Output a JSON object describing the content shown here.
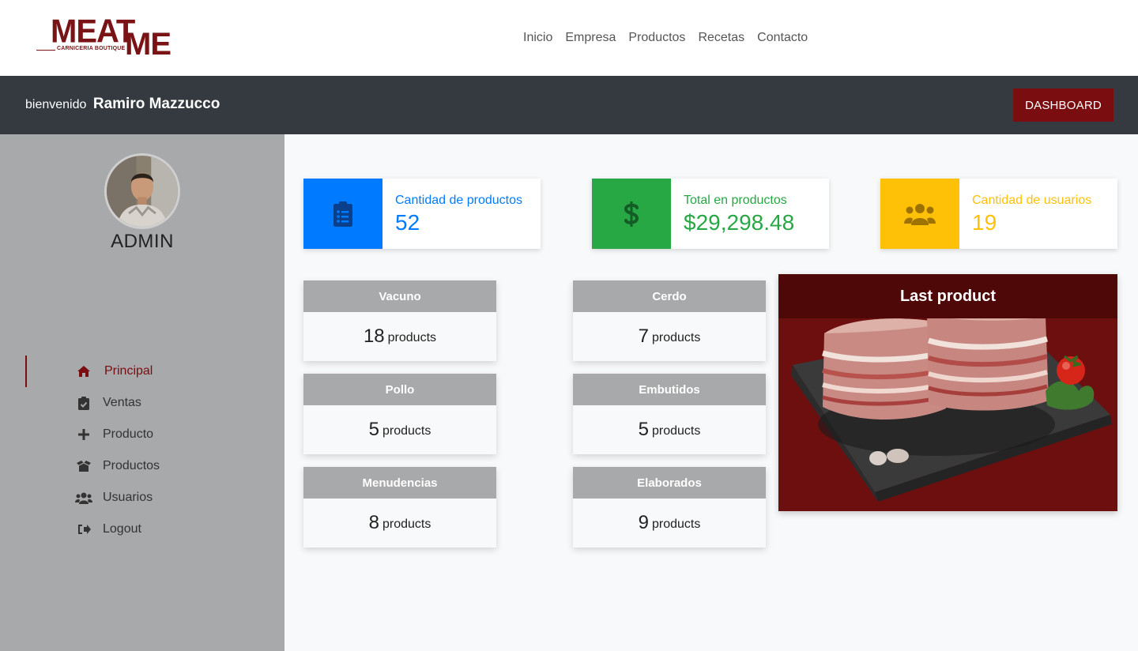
{
  "brand": {
    "word1": "MEAT",
    "word2": "ME",
    "tagline": "CARNICERIA BOUTIQUE"
  },
  "nav": [
    "Inicio",
    "Empresa",
    "Productos",
    "Recetas",
    "Contacto"
  ],
  "welcome": {
    "greeting": "bienvenido",
    "user": "Ramiro Mazzucco",
    "button": "DASHBOARD"
  },
  "sidebar": {
    "role": "ADMIN",
    "menu": [
      {
        "label": "Principal",
        "icon": "home-icon"
      },
      {
        "label": "Ventas",
        "icon": "clipboard-check-icon"
      },
      {
        "label": "Producto",
        "icon": "plus-icon"
      },
      {
        "label": "Productos",
        "icon": "boxes-icon"
      },
      {
        "label": "Usuarios",
        "icon": "users-icon"
      },
      {
        "label": "Logout",
        "icon": "logout-icon"
      }
    ]
  },
  "stats": [
    {
      "label": "Cantidad de productos",
      "value": "52",
      "icon": "clipboard-list-icon",
      "color": "#007bff"
    },
    {
      "label": "Total en productos",
      "value": "$29,298.48",
      "icon": "dollar-icon",
      "color": "#28a745"
    },
    {
      "label": "Cantidad de usuarios",
      "value": "19",
      "icon": "users-icon",
      "color": "#ffc107"
    }
  ],
  "categories": [
    {
      "name": "Vacuno",
      "count": "18",
      "unit": "products"
    },
    {
      "name": "Cerdo",
      "count": "7",
      "unit": "products"
    },
    {
      "name": "Pollo",
      "count": "5",
      "unit": "products"
    },
    {
      "name": "Embutidos",
      "count": "5",
      "unit": "products"
    },
    {
      "name": "Menudencias",
      "count": "8",
      "unit": "products"
    },
    {
      "name": "Elaborados",
      "count": "9",
      "unit": "products"
    }
  ],
  "last_product": {
    "title": "Last product"
  },
  "colors": {
    "brand": "#7a0d10",
    "dark": "#343a40",
    "sidebar": "#a8a9ab"
  }
}
